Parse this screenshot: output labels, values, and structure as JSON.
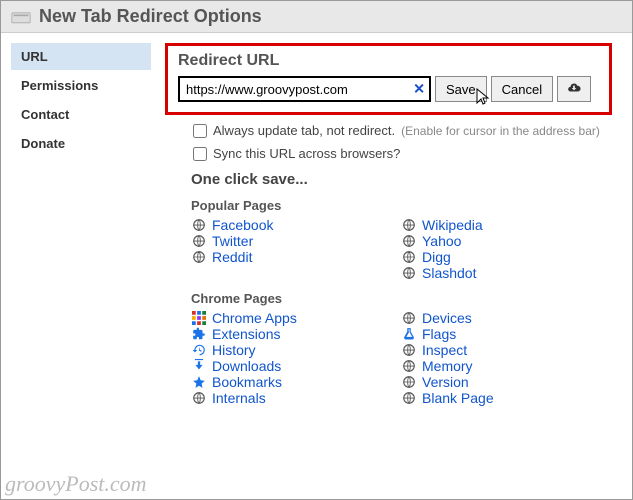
{
  "title": "New Tab Redirect Options",
  "sidebar": {
    "items": [
      {
        "label": "URL",
        "active": true
      },
      {
        "label": "Permissions"
      },
      {
        "label": "Contact"
      },
      {
        "label": "Donate"
      }
    ]
  },
  "redirect": {
    "heading": "Redirect URL",
    "url_value": "https://www.groovypost.com",
    "save_label": "Save",
    "cancel_label": "Cancel"
  },
  "options": {
    "always_update_label": "Always update tab, not redirect.",
    "always_update_hint": "(Enable for cursor in the address bar)",
    "sync_label": "Sync this URL across browsers?"
  },
  "one_click_heading": "One click save...",
  "groups": {
    "popular_title": "Popular Pages",
    "popular_col1": [
      "Facebook",
      "Twitter",
      "Reddit"
    ],
    "popular_col2": [
      "Wikipedia",
      "Yahoo",
      "Digg",
      "Slashdot"
    ],
    "chrome_title": "Chrome Pages",
    "chrome_col1": [
      {
        "label": "Chrome Apps",
        "icon": "apps-grid"
      },
      {
        "label": "Extensions",
        "icon": "puzzle"
      },
      {
        "label": "History",
        "icon": "history"
      },
      {
        "label": "Downloads",
        "icon": "download"
      },
      {
        "label": "Bookmarks",
        "icon": "star"
      },
      {
        "label": "Internals",
        "icon": "globe"
      }
    ],
    "chrome_col2": [
      {
        "label": "Devices",
        "icon": "globe"
      },
      {
        "label": "Flags",
        "icon": "flask"
      },
      {
        "label": "Inspect",
        "icon": "globe"
      },
      {
        "label": "Memory",
        "icon": "globe"
      },
      {
        "label": "Version",
        "icon": "globe"
      },
      {
        "label": "Blank Page",
        "icon": "globe"
      }
    ]
  },
  "watermark": "groovyPost.com"
}
